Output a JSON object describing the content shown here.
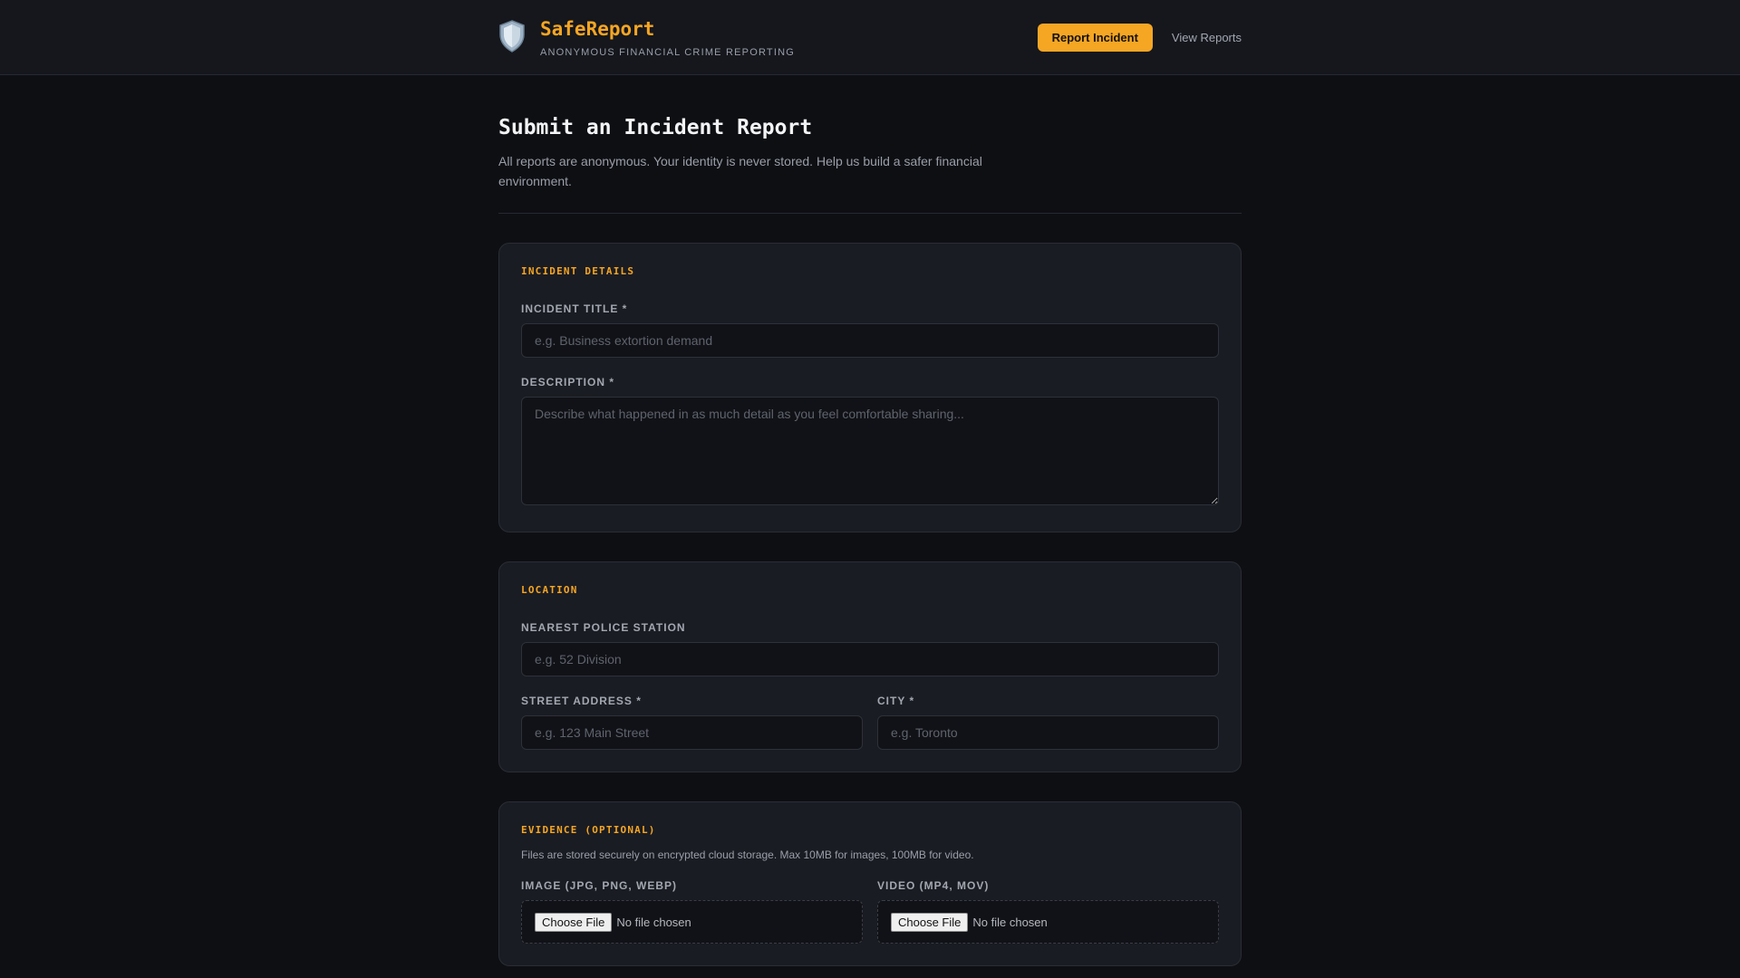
{
  "header": {
    "brand_name": "SafeReport",
    "brand_tagline": "ANONYMOUS FINANCIAL CRIME REPORTING",
    "brand_icon": "shield-icon",
    "report_button": "Report Incident",
    "view_link": "View Reports"
  },
  "page": {
    "title": "Submit an Incident Report",
    "description": "All reports are anonymous. Your identity is never stored. Help us build a safer financial environment."
  },
  "incident": {
    "section_title": "INCIDENT DETAILS",
    "title_label": "INCIDENT TITLE *",
    "title_placeholder": "e.g. Business extortion demand",
    "title_value": "",
    "description_label": "DESCRIPTION *",
    "description_placeholder": "Describe what happened in as much detail as you feel comfortable sharing...",
    "description_value": ""
  },
  "location": {
    "section_title": "LOCATION",
    "station_label": "NEAREST POLICE STATION",
    "station_placeholder": "e.g. 52 Division",
    "address_label": "STREET ADDRESS *",
    "address_placeholder": "e.g. 123 Main Street",
    "city_label": "CITY *",
    "city_placeholder": "e.g. Toronto"
  },
  "evidence": {
    "section_title": "EVIDENCE (OPTIONAL)",
    "note": "Files are stored securely on encrypted cloud storage. Max 10MB for images, 100MB for video.",
    "image_label": "IMAGE (JPG, PNG, WEBP)",
    "video_label": "VIDEO (MP4, MOV)",
    "choose_file": "Choose File",
    "no_file": "No file chosen"
  },
  "colors": {
    "accent": "#f5a623",
    "background": "#0e0f13",
    "card": "#1a1c23",
    "header": "#15171d"
  }
}
